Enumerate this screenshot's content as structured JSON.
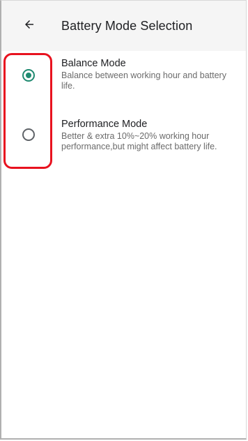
{
  "header": {
    "title": "Battery Mode Selection",
    "back_icon": "arrow-left-icon"
  },
  "options": [
    {
      "title": "Balance Mode",
      "description": "Balance between working hour and battery life.",
      "selected": true
    },
    {
      "title": "Performance Mode",
      "description": "Better & extra 10%~20% working hour performance,but might affect battery life.",
      "selected": false
    }
  ],
  "colors": {
    "accent": "#1f8a70",
    "highlight": "#e8121f"
  }
}
